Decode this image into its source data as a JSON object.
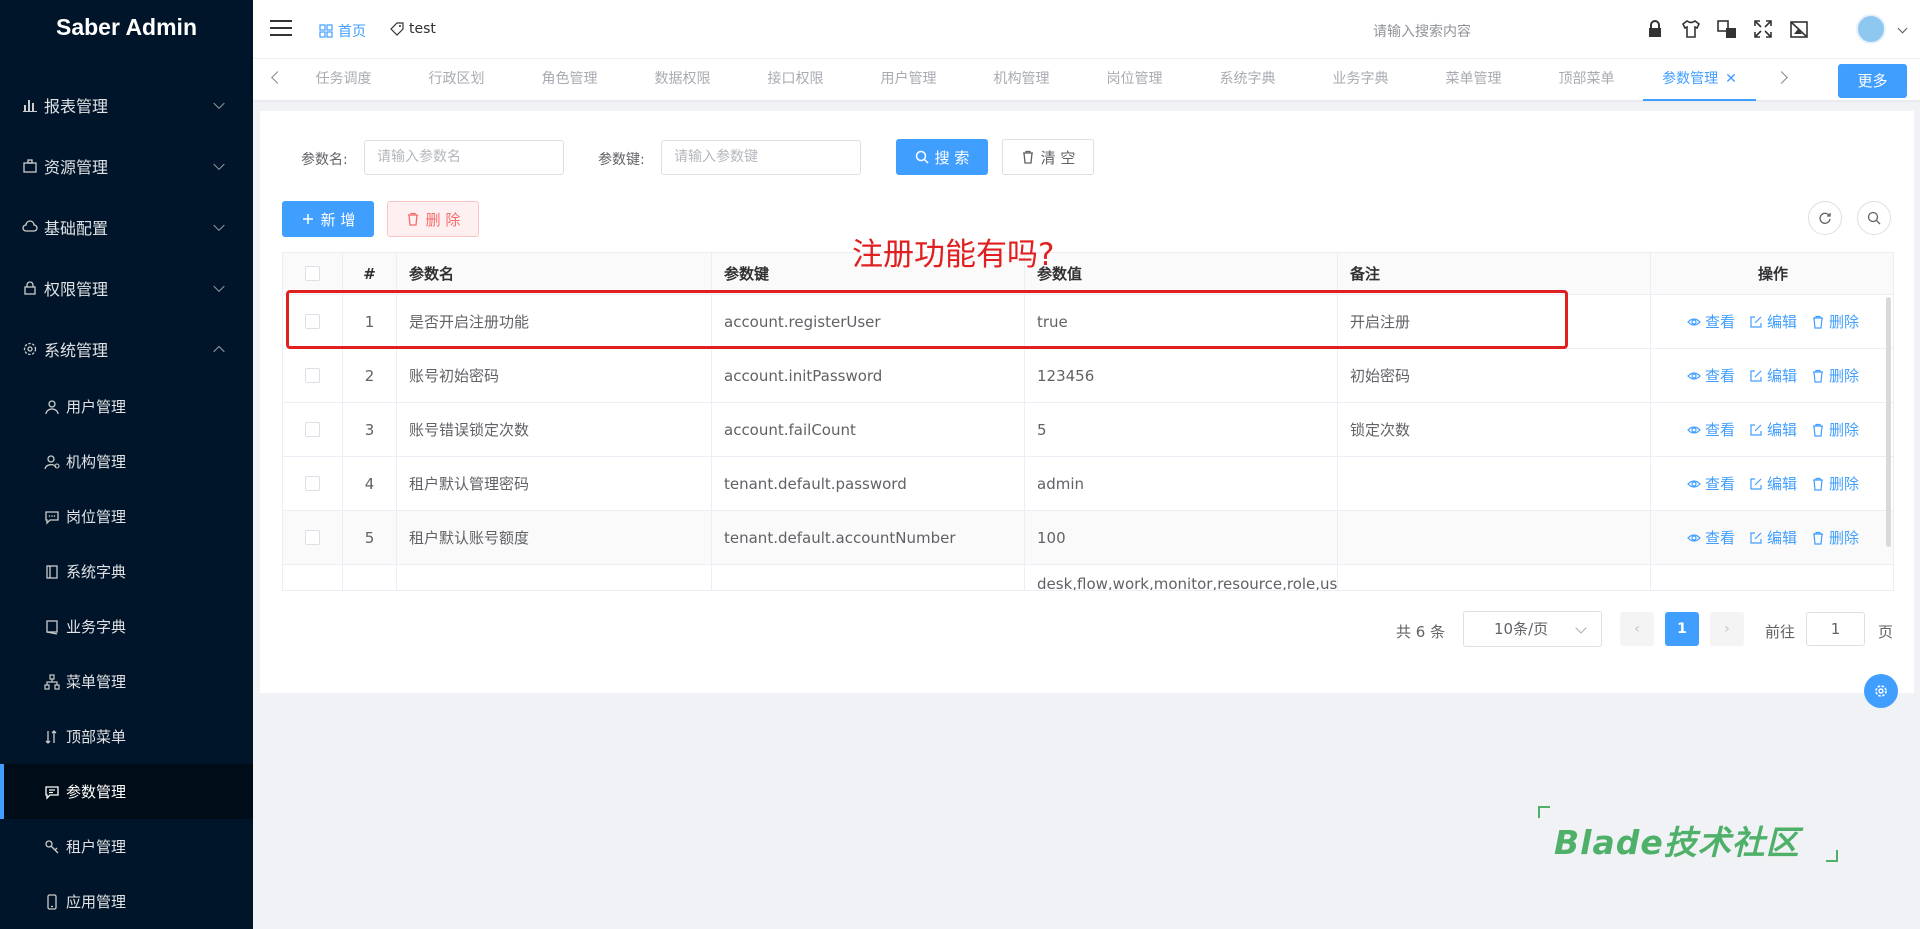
{
  "app": {
    "title": "Saber Admin"
  },
  "sidebar": {
    "menus": [
      {
        "label": "报表管理",
        "icon": "bar-chart-icon"
      },
      {
        "label": "资源管理",
        "icon": "briefcase-icon"
      },
      {
        "label": "基础配置",
        "icon": "cloud-icon"
      },
      {
        "label": "权限管理",
        "icon": "lock-icon"
      },
      {
        "label": "系统管理",
        "icon": "gear-icon"
      }
    ],
    "sub_items": [
      {
        "label": "用户管理",
        "icon": "user-icon"
      },
      {
        "label": "机构管理",
        "icon": "org-user-icon"
      },
      {
        "label": "岗位管理",
        "icon": "message-icon"
      },
      {
        "label": "系统字典",
        "icon": "dict-icon"
      },
      {
        "label": "业务字典",
        "icon": "book-icon"
      },
      {
        "label": "菜单管理",
        "icon": "tree-icon"
      },
      {
        "label": "顶部菜单",
        "icon": "sort-icon"
      },
      {
        "label": "参数管理",
        "icon": "chat-icon"
      },
      {
        "label": "租户管理",
        "icon": "key-icon"
      },
      {
        "label": "应用管理",
        "icon": "phone-icon"
      }
    ]
  },
  "header": {
    "home_tab": "首页",
    "test_tab": "test",
    "search_placeholder": "请输入搜索内容",
    "icons": [
      "lock-icon",
      "shirt-icon",
      "translate-icon",
      "fullscreen-icon",
      "screenshot-icon"
    ]
  },
  "tags": {
    "items": [
      "任务调度",
      "行政区划",
      "角色管理",
      "数据权限",
      "接口权限",
      "用户管理",
      "机构管理",
      "岗位管理",
      "系统字典",
      "业务字典",
      "菜单管理",
      "顶部菜单"
    ],
    "active": "参数管理",
    "close_symbol": "✕",
    "more_label": "更多"
  },
  "search": {
    "name_label": "参数名:",
    "name_placeholder": "请输入参数名",
    "key_label": "参数键:",
    "key_placeholder": "请输入参数键",
    "search_btn": "搜 索",
    "clear_btn": "清 空"
  },
  "toolbar": {
    "add_btn": "新 增",
    "delete_btn": "删 除"
  },
  "annotation": "注册功能有吗?",
  "table": {
    "headers": {
      "index": "#",
      "name": "参数名",
      "key": "参数键",
      "value": "参数值",
      "note": "备注",
      "ops": "操作"
    },
    "ops": {
      "view": "查看",
      "edit": "编辑",
      "delete": "删除"
    },
    "rows": [
      {
        "index": "1",
        "name": "是否开启注册功能",
        "key": "account.registerUser",
        "value": "true",
        "note": "开启注册"
      },
      {
        "index": "2",
        "name": "账号初始密码",
        "key": "account.initPassword",
        "value": "123456",
        "note": "初始密码"
      },
      {
        "index": "3",
        "name": "账号错误锁定次数",
        "key": "account.failCount",
        "value": "5",
        "note": "锁定次数"
      },
      {
        "index": "4",
        "name": "租户默认管理密码",
        "key": "tenant.default.password",
        "value": "admin",
        "note": ""
      },
      {
        "index": "5",
        "name": "租户默认账号额度",
        "key": "tenant.default.accountNumber",
        "value": "100",
        "note": ""
      },
      {
        "index": "",
        "name": "",
        "key": "",
        "value": "desk,flow,work,monitor,resource,role,user",
        "note": ""
      }
    ]
  },
  "pagination": {
    "total": "共 6 条",
    "page_size": "10条/页",
    "prev": "‹",
    "current": "1",
    "next": "›",
    "goto_label": "前往",
    "goto_value": "1",
    "page_suffix": "页"
  },
  "watermark": "Blade技术社区",
  "colors": {
    "primary": "#409eff",
    "sidebar": "#001529",
    "annotation": "#e02020",
    "watermark": "#4fb06a"
  }
}
